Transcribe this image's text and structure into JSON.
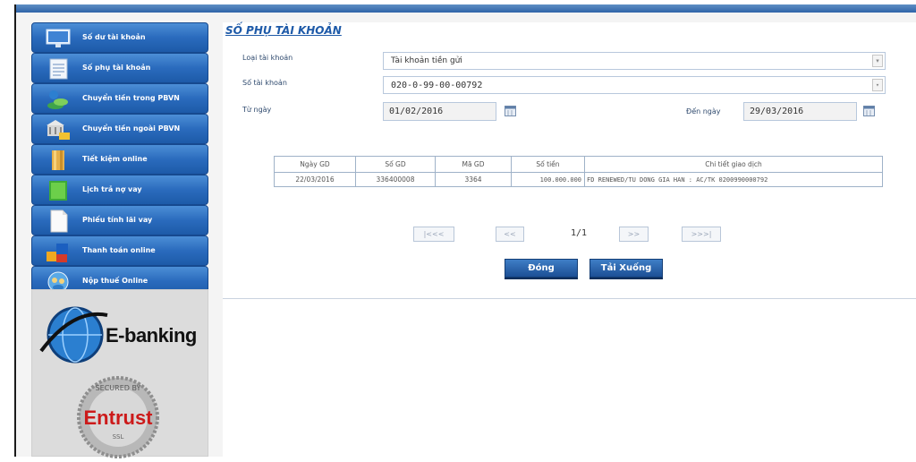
{
  "sidebar": {
    "items": [
      {
        "label": "Số dư tài khoản",
        "icon": "monitor-icon"
      },
      {
        "label": "Số phụ tài khoản",
        "icon": "statement-icon"
      },
      {
        "label": "Chuyển tiền trong PBVN",
        "icon": "transfer-internal-icon"
      },
      {
        "label": "Chuyển tiền ngoài PBVN",
        "icon": "bank-transfer-icon"
      },
      {
        "label": "Tiết kiệm online",
        "icon": "savings-icon"
      },
      {
        "label": "Lịch trả nợ vay",
        "icon": "calendar-book-icon"
      },
      {
        "label": "Phiếu tính lãi vay",
        "icon": "document-icon"
      },
      {
        "label": "Thanh toán online",
        "icon": "payment-blocks-icon"
      },
      {
        "label": "Nộp thuế Online",
        "icon": "globe-people-icon"
      }
    ]
  },
  "logos": {
    "ebanking_text": "E-banking",
    "seal_text": "Entrust"
  },
  "page": {
    "title": "SỐ PHỤ TÀI KHOẢN"
  },
  "form": {
    "account_type_label": "Loại tài khoản",
    "account_type_value": "Tài khoản tiền gửi",
    "account_no_label": "Số tài khoản",
    "account_no_value": "020-0-99-00-00792",
    "from_label": "Từ ngày",
    "from_value": "01/02/2016",
    "to_label": "Đến ngày",
    "to_value": "29/03/2016"
  },
  "table": {
    "headers": [
      "Ngày GD",
      "Số GD",
      "Mã GD",
      "Số tiền",
      "Chi tiết giao dịch"
    ],
    "rows": [
      [
        "22/03/2016",
        "336400008",
        "3364",
        "100.000.000",
        "FD RENEWED/TU DONG GIA HAN : AC/TK 0200990000792"
      ]
    ]
  },
  "pager": {
    "first": "|<<<",
    "prev": "<<",
    "info": "1/1",
    "next": ">>",
    "last": ">>>|"
  },
  "buttons": {
    "close": "Đóng",
    "download": "Tải Xuống"
  },
  "colors": {
    "nav_blue": "#2a6bbd",
    "title_blue": "#1e5aa8"
  }
}
